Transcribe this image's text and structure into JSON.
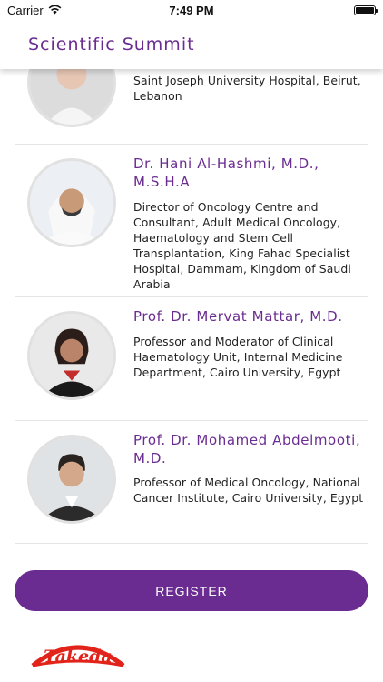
{
  "status_bar": {
    "carrier": "Carrier",
    "time": "7:49 PM"
  },
  "header": {
    "title": "Scientific Summit"
  },
  "speakers": [
    {
      "name": "",
      "description": "Saint Joseph University Hospital, Beirut, Lebanon",
      "photo_icon": "speaker-photo-icon"
    },
    {
      "name": "Dr. Hani Al-Hashmi, M.D., M.S.H.A",
      "description": "Director of Oncology Centre and Consultant, Adult Medical Oncology, Haematology and Stem Cell Transplantation, King Fahad Specialist Hospital, Dammam, Kingdom of Saudi Arabia",
      "photo_icon": "speaker-photo-icon"
    },
    {
      "name": "Prof. Dr. Mervat Mattar, M.D.",
      "description": "Professor and Moderator of Clinical Haematology Unit, Internal Medicine Department, Cairo University, Egypt",
      "photo_icon": "speaker-photo-icon"
    },
    {
      "name": "Prof. Dr. Mohamed Abdelmooti, M.D.",
      "description": "Professor of Medical Oncology, National Cancer Institute, Cairo University, Egypt",
      "photo_icon": "speaker-photo-icon"
    }
  ],
  "register": {
    "label": "REGISTER"
  },
  "logo": {
    "text": "Takeda"
  },
  "colors": {
    "accent": "#6a2c91",
    "logo_red": "#e2231a"
  }
}
